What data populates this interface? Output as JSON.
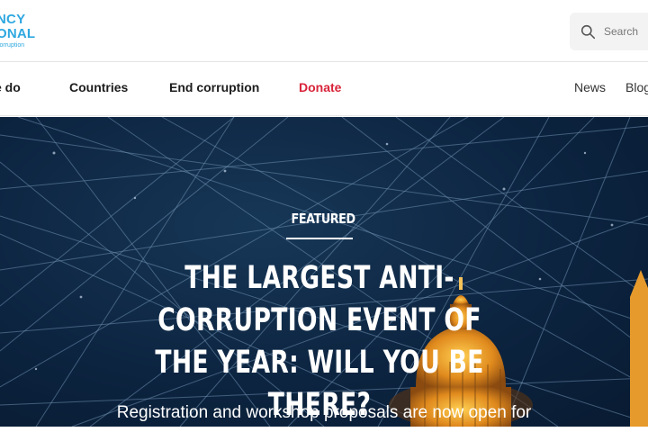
{
  "header": {
    "logo_line1": "NCY",
    "logo_line2": "ONAL",
    "logo_line3": "corruption",
    "search_placeholder": "Search",
    "search_icon": "search-icon"
  },
  "nav": {
    "items": [
      {
        "label": "e do"
      },
      {
        "label": "Countries"
      },
      {
        "label": "End corruption"
      },
      {
        "label": "Donate"
      },
      {
        "label": "News"
      },
      {
        "label": "Blog"
      }
    ]
  },
  "hero": {
    "eyebrow": "FEATURED",
    "headline": "THE LARGEST ANTI-CORRUPTION EVENT OF THE YEAR: WILL YOU BE THERE?",
    "subline": "Registration and workshop proposals are now open for"
  },
  "colors": {
    "accent": "#2fa8e0",
    "donate": "#d8243a",
    "hero_bg": "#0c2440"
  }
}
